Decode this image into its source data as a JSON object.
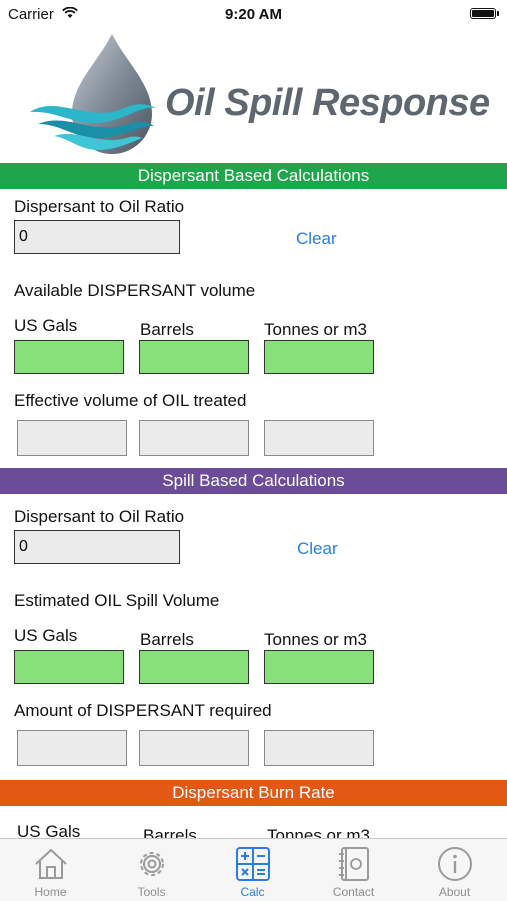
{
  "status_bar": {
    "carrier": "Carrier",
    "time": "9:20 AM"
  },
  "app": {
    "logo_text": "Oil Spill Response"
  },
  "colors": {
    "green": "#1fa54a",
    "purple": "#6a4c98",
    "orange": "#e25814",
    "link": "#2a7de1",
    "input_green": "#88e07a"
  },
  "dispersant_section": {
    "title": "Dispersant Based Calculations",
    "ratio_label": "Dispersant to Oil Ratio",
    "ratio_value": "0",
    "clear_label": "Clear",
    "available_label": "Available DISPERSANT volume",
    "col_us_gals": "US Gals",
    "col_barrels": "Barrels",
    "col_tonnes": "Tonnes or m3",
    "effective_label": "Effective volume of OIL treated"
  },
  "spill_section": {
    "title": "Spill Based Calculations",
    "ratio_label": "Dispersant to Oil Ratio",
    "ratio_value": "0",
    "clear_label": "Clear",
    "estimated_label": "Estimated OIL Spill Volume",
    "col_us_gals": "US Gals",
    "col_barrels": "Barrels",
    "col_tonnes": "Tonnes or m3",
    "amount_label": "Amount of DISPERSANT required"
  },
  "burn_section": {
    "title": "Dispersant Burn Rate",
    "col_us_gals": "US Gals",
    "col_barrels": "Barrels",
    "col_tonnes": "Tonnes or m3"
  },
  "tabbar": {
    "items": [
      {
        "label": "Home",
        "icon": "home-icon"
      },
      {
        "label": "Tools",
        "icon": "gear-icon"
      },
      {
        "label": "Calc",
        "icon": "calculator-icon",
        "active": true
      },
      {
        "label": "Contact",
        "icon": "contact-book-icon"
      },
      {
        "label": "About",
        "icon": "info-icon"
      }
    ]
  }
}
